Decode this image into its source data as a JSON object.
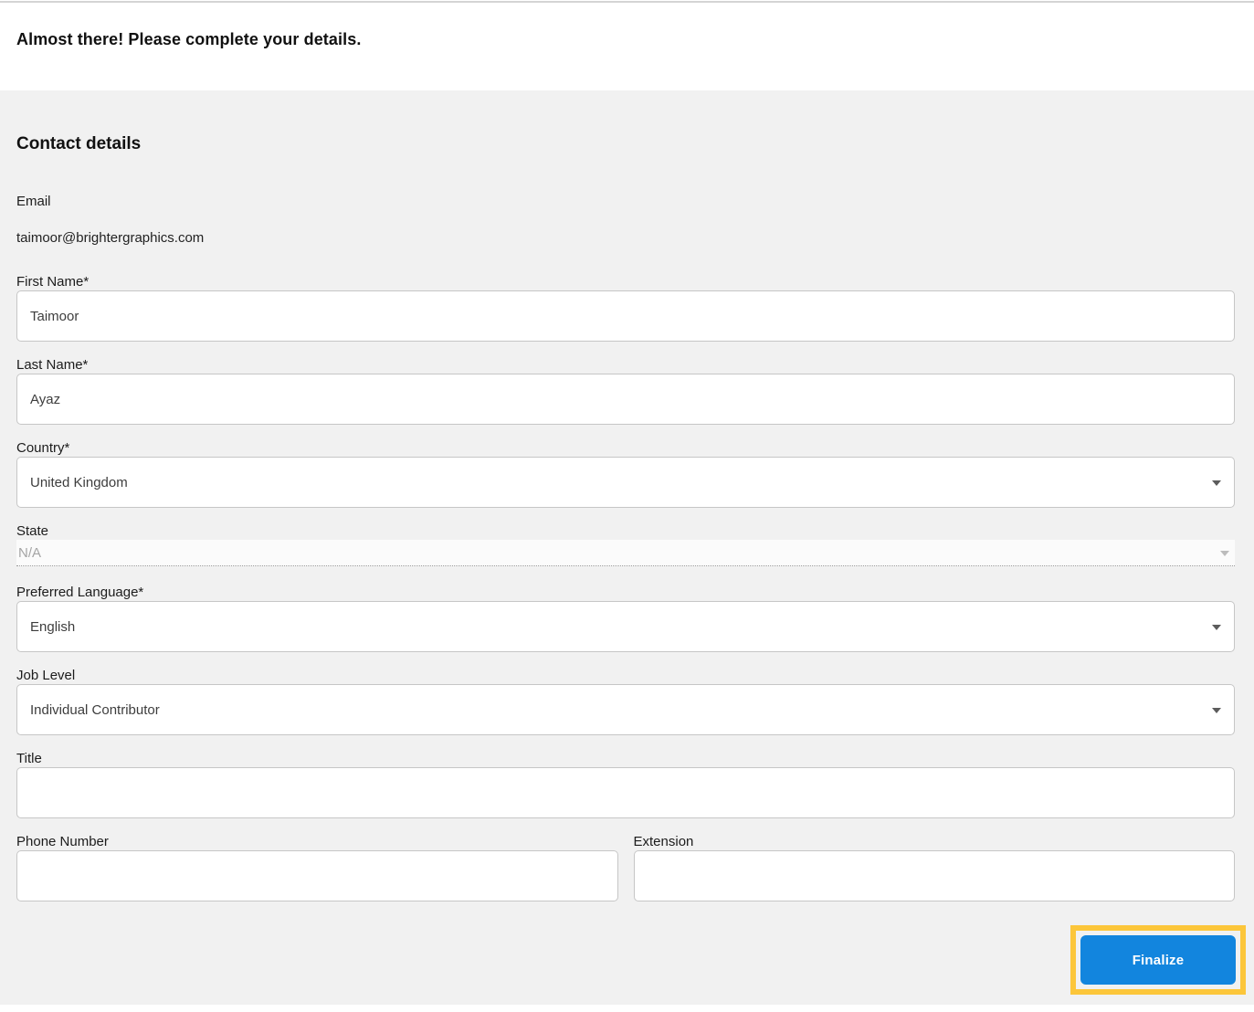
{
  "colors": {
    "accent_blue": "#1285de",
    "highlight_yellow": "#fcc63a",
    "page_background": "#f1f1f1"
  },
  "header": {
    "title": "Almost there! Please complete your details."
  },
  "form": {
    "heading": "Contact details",
    "email": {
      "label": "Email",
      "value": "taimoor@brightergraphics.com"
    },
    "first_name": {
      "label": "First Name*",
      "value": "Taimoor"
    },
    "last_name": {
      "label": "Last Name*",
      "value": "Ayaz"
    },
    "country": {
      "label": "Country*",
      "value": "United Kingdom"
    },
    "state": {
      "label": "State",
      "value": "N/A"
    },
    "preferred_language": {
      "label": "Preferred Language*",
      "value": "English"
    },
    "job_level": {
      "label": "Job Level",
      "value": "Individual Contributor"
    },
    "title_field": {
      "label": "Title",
      "value": ""
    },
    "phone": {
      "label": "Phone Number",
      "value": ""
    },
    "extension": {
      "label": "Extension",
      "value": ""
    },
    "finalize_label": "Finalize"
  }
}
